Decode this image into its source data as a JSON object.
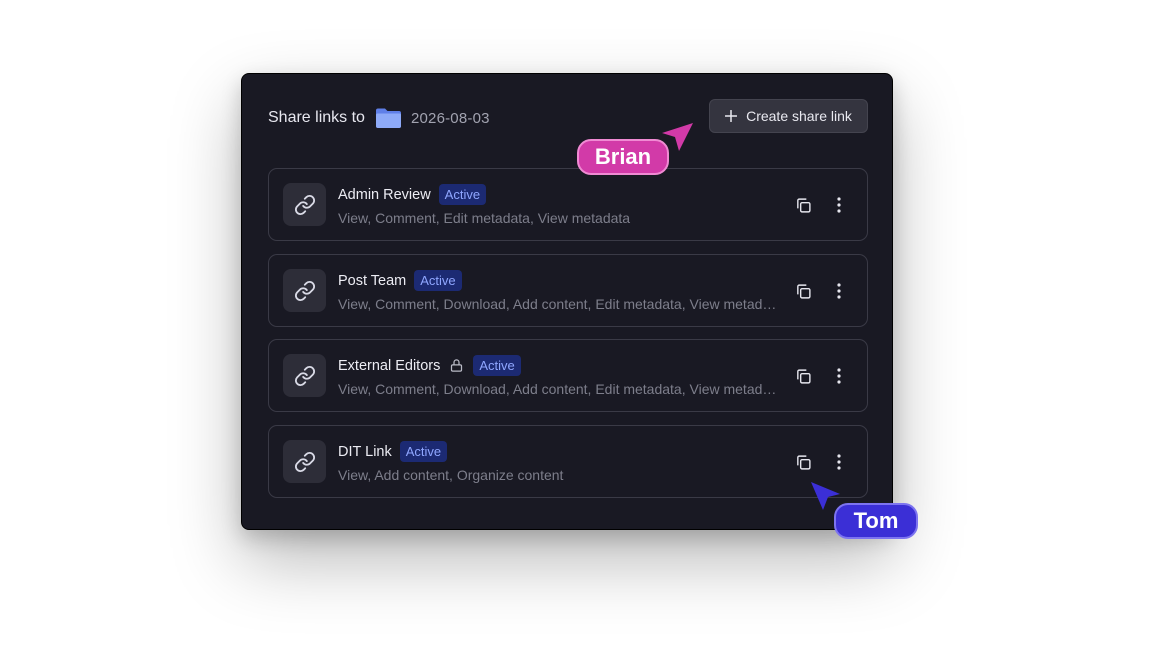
{
  "header": {
    "title": "Share links to",
    "folder_icon": "folder-icon",
    "folder_name": "2026-08-03",
    "create_button_label": "Create share link"
  },
  "links": [
    {
      "name": "Admin Review",
      "status": "Active",
      "locked": false,
      "permissions": "View, Comment, Edit metadata, View metadata"
    },
    {
      "name": "Post Team",
      "status": "Active",
      "locked": false,
      "permissions": "View, Comment, Download, Add content, Edit metadata, View metadata"
    },
    {
      "name": "External Editors",
      "status": "Active",
      "locked": true,
      "permissions": "View, Comment, Download, Add content, Edit metadata, View metadata"
    },
    {
      "name": "DIT Link",
      "status": "Active",
      "locked": false,
      "permissions": "View, Add content, Organize content"
    }
  ],
  "cursors": [
    {
      "name": "Brian",
      "color": "#d23aa8"
    },
    {
      "name": "Tom",
      "color": "#3b2fd6"
    }
  ],
  "colors": {
    "panel_bg": "#191923",
    "badge_bg": "#1c2a73",
    "badge_text": "#8fa6ff",
    "folder": "#7d9bf5"
  }
}
